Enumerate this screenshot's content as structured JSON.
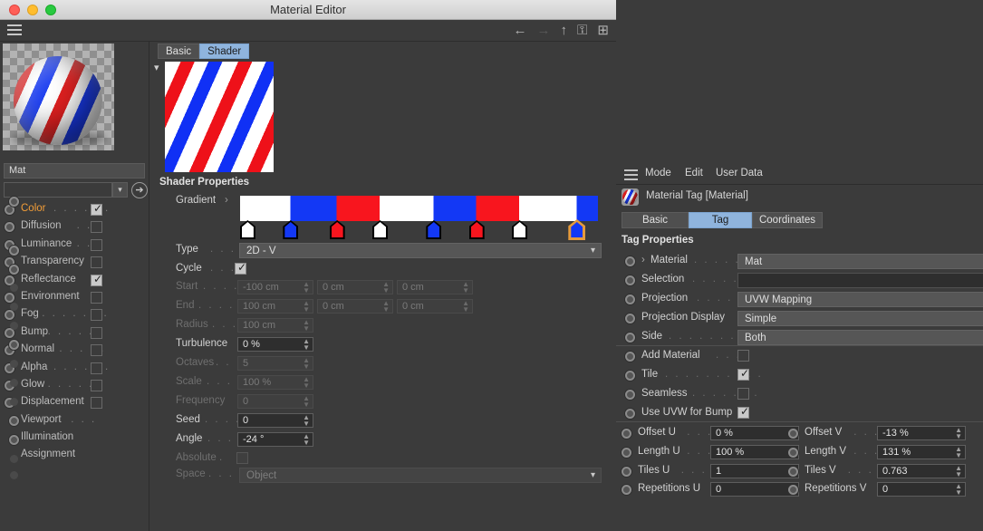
{
  "window": {
    "title": "Material Editor",
    "traffic_lights": [
      "close",
      "minimize",
      "zoom"
    ]
  },
  "toolbar": {
    "menu_icon": "hamburger-icon",
    "icons": [
      {
        "name": "back-arrow-icon",
        "glyph": "←",
        "enabled": true
      },
      {
        "name": "forward-arrow-icon",
        "glyph": "→",
        "enabled": false
      },
      {
        "name": "up-arrow-icon",
        "glyph": "↑",
        "enabled": true
      },
      {
        "name": "lock-icon",
        "glyph": "⚿",
        "enabled": true
      },
      {
        "name": "add-box-icon",
        "glyph": "⊞",
        "enabled": true
      }
    ]
  },
  "left_panel": {
    "material_name": "Mat",
    "channels": [
      {
        "label": "Color",
        "dots": ". . . . . .",
        "checked": true,
        "active": true,
        "has_checkbox": true
      },
      {
        "label": "Diffusion",
        "dots": ". . .",
        "checked": false,
        "active": false,
        "has_checkbox": true
      },
      {
        "label": "Luminance",
        "dots": ". .",
        "checked": false,
        "active": false,
        "has_checkbox": true
      },
      {
        "label": "Transparency",
        "dots": "",
        "checked": false,
        "active": false,
        "has_checkbox": true
      },
      {
        "label": "Reflectance",
        "dots": "",
        "checked": true,
        "active": false,
        "has_checkbox": true
      },
      {
        "label": "Environment",
        "dots": "",
        "checked": false,
        "active": false,
        "has_checkbox": true
      },
      {
        "label": "Fog",
        "dots": ". . . . . . .",
        "checked": false,
        "active": false,
        "has_checkbox": true
      },
      {
        "label": "Bump",
        "dots": ". . . . . .",
        "checked": false,
        "active": false,
        "has_checkbox": true
      },
      {
        "label": "Normal",
        "dots": ". . . . .",
        "checked": false,
        "active": false,
        "has_checkbox": true
      },
      {
        "label": "Alpha",
        "dots": ". . . . . .",
        "checked": false,
        "active": false,
        "has_checkbox": true
      },
      {
        "label": "Glow",
        "dots": ". . . . . .",
        "checked": false,
        "active": false,
        "has_checkbox": true
      },
      {
        "label": "Displacement",
        "dots": "",
        "checked": false,
        "active": false,
        "has_checkbox": true
      },
      {
        "label": "Viewport",
        "dots": ". . .",
        "checked": false,
        "active": false,
        "has_checkbox": false
      },
      {
        "label": "Illumination",
        "dots": "",
        "checked": false,
        "active": false,
        "has_checkbox": false
      },
      {
        "label": "Assignment",
        "dots": "",
        "checked": false,
        "active": false,
        "has_checkbox": false
      }
    ]
  },
  "center_panel": {
    "tabs": [
      {
        "label": "Basic",
        "active": false
      },
      {
        "label": "Shader",
        "active": true
      }
    ],
    "section_title": "Shader Properties",
    "gradient": {
      "label": "Gradient",
      "expand_glyph": "›",
      "stops": [
        {
          "color": "#ffffff",
          "position": 2,
          "selected": false
        },
        {
          "color": "#1338f5",
          "position": 14,
          "selected": false
        },
        {
          "color": "#f8151e",
          "position": 27,
          "selected": false
        },
        {
          "color": "#ffffff",
          "position": 39,
          "selected": false
        },
        {
          "color": "#1338f5",
          "position": 54,
          "selected": false
        },
        {
          "color": "#f8151e",
          "position": 66,
          "selected": false
        },
        {
          "color": "#ffffff",
          "position": 78,
          "selected": false
        },
        {
          "color": "#1338f5",
          "position": 94,
          "selected": true
        }
      ],
      "bands": [
        {
          "color": "#ffffff",
          "start": 0,
          "end": 14
        },
        {
          "color": "#1338f5",
          "start": 14,
          "end": 27
        },
        {
          "color": "#f8151e",
          "start": 27,
          "end": 39
        },
        {
          "color": "#ffffff",
          "start": 39,
          "end": 54
        },
        {
          "color": "#1338f5",
          "start": 54,
          "end": 66
        },
        {
          "color": "#f8151e",
          "start": 66,
          "end": 78
        },
        {
          "color": "#ffffff",
          "start": 78,
          "end": 94
        },
        {
          "color": "#1338f5",
          "start": 94,
          "end": 100
        }
      ]
    },
    "type": {
      "label": "Type",
      "dots": ". . . .",
      "value": "2D - V"
    },
    "cycle": {
      "label": "Cycle",
      "dots": ". . . .",
      "checked": true
    },
    "start": {
      "label": "Start",
      "dots": ". . . .",
      "x": "-100 cm",
      "y": "0 cm",
      "z": "0 cm",
      "enabled": false
    },
    "end": {
      "label": "End",
      "dots": ". . . . .",
      "x": "100 cm",
      "y": "0 cm",
      "z": "0 cm",
      "enabled": false
    },
    "radius": {
      "label": "Radius",
      "dots": ". . .",
      "value": "100 cm",
      "enabled": false
    },
    "turbulence": {
      "label": "Turbulence",
      "dots": "",
      "value": "0 %",
      "enabled": true
    },
    "octaves": {
      "label": "Octaves",
      "dots": ". .",
      "value": "5",
      "enabled": false
    },
    "scale": {
      "label": "Scale",
      "dots": ". . . .",
      "value": "100 %",
      "enabled": false
    },
    "frequency": {
      "label": "Frequency",
      "dots": "",
      "value": "0",
      "enabled": false
    },
    "seed": {
      "label": "Seed",
      "dots": ". . . .",
      "value": "0",
      "enabled": true
    },
    "angle": {
      "label": "Angle",
      "dots": ". . . .",
      "value": "-24 °",
      "enabled": true
    },
    "absolute": {
      "label": "Absolute",
      "dots": ".",
      "checked": false,
      "enabled": false
    },
    "space": {
      "label": "Space",
      "dots": ". . .",
      "value": "Object",
      "enabled": false
    }
  },
  "right_panel": {
    "menu": {
      "hamburger": "hamburger-icon",
      "items": [
        "Mode",
        "Edit",
        "User Data"
      ]
    },
    "object_title": "Material Tag [Material]",
    "tabs": [
      {
        "label": "Basic",
        "active": false
      },
      {
        "label": "Tag",
        "active": true
      },
      {
        "label": "Coordinates",
        "active": false
      }
    ],
    "section_title": "Tag Properties",
    "rows": [
      {
        "label": "Material",
        "prefix": "›",
        "dots": ". . . . . .",
        "value": "Mat",
        "type": "field"
      },
      {
        "label": "Selection",
        "dots": ". . . . . . .",
        "value": "",
        "type": "empty"
      },
      {
        "label": "Projection",
        "dots": ". . . . . .",
        "value": "UVW Mapping",
        "type": "field"
      },
      {
        "label": "Projection Display",
        "dots": "",
        "value": "Simple",
        "type": "field"
      },
      {
        "label": "Side",
        "dots": ". . . . . . . . . .",
        "value": "Both",
        "type": "field"
      }
    ],
    "checkboxes": [
      {
        "label": "Add Material",
        "dots": ". . . .",
        "checked": false
      },
      {
        "label": "Tile",
        "dots": ". . . . . . . . . .",
        "checked": true
      },
      {
        "label": "Seamless",
        "dots": ". . . . . . .",
        "checked": false
      },
      {
        "label": "Use UVW for Bump",
        "dots": "",
        "checked": true
      }
    ],
    "uv_grid": [
      {
        "label": "Offset U",
        "dots": ". . . .",
        "value": "0 %"
      },
      {
        "label": "Offset V",
        "dots": ". . . .",
        "value": "-13 %"
      },
      {
        "label": "Length U",
        "dots": ". . .",
        "value": "100 %"
      },
      {
        "label": "Length V",
        "dots": ". . .",
        "value": "131 %"
      },
      {
        "label": "Tiles U",
        "dots": ". . . . .",
        "value": "1"
      },
      {
        "label": "Tiles V",
        "dots": ". . . . .",
        "value": "0.763"
      },
      {
        "label": "Repetitions U",
        "dots": "",
        "value": "0"
      },
      {
        "label": "Repetitions V",
        "dots": "",
        "value": "0"
      }
    ]
  },
  "colors": {
    "accent_orange": "#f29d38",
    "tab_active_blue": "#8fb4dd",
    "stripe_red": "#f8151e",
    "stripe_blue": "#1338f5",
    "stripe_white": "#ffffff",
    "panel_bg": "#3b3b3b"
  }
}
